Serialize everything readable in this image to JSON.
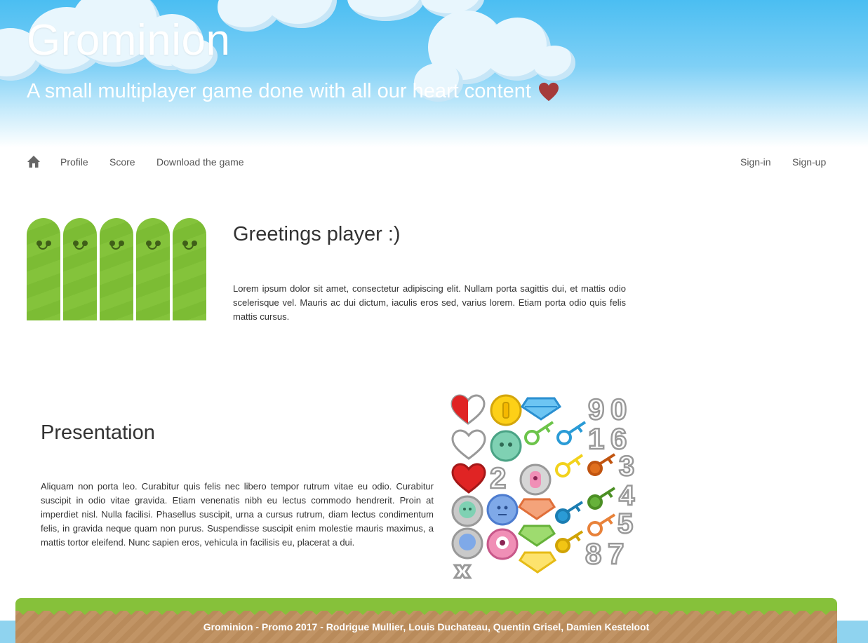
{
  "header": {
    "title": "Grominion",
    "subtitle": "A small multiplayer game done with all our heart content",
    "subtitle_icon": "heart-icon",
    "heart_color": "#a53b3b",
    "sky_color": "#4bbef2"
  },
  "nav": {
    "home_icon": "home-icon",
    "items": [
      "Profile",
      "Score",
      "Download the game"
    ],
    "right_items": [
      "Sign-in",
      "Sign-up"
    ]
  },
  "greetings": {
    "heading": "Greetings player :)",
    "text": "Lorem ipsum dolor sit amet, consectetur adipiscing elit. Nullam porta sagittis dui, et mattis odio scelerisque vel. Mauris ac dui dictum, iaculis eros sed, varius lorem. Etiam porta odio quis felis mattis cursus."
  },
  "presentation": {
    "heading": "Presentation",
    "text": "Aliquam non porta leo. Curabitur quis felis nec libero tempor rutrum vitae eu odio. Curabitur suscipit in odio vitae gravida. Etiam venenatis nibh eu lectus commodo hendrerit. Proin at imperdiet nisl. Nulla facilisi. Phasellus suscipit, urna a cursus rutrum, diam lectus condimentum felis, in gravida neque quam non purus. Suspendisse suscipit enim molestie mauris maximus, a mattis tortor eleifend. Nunc sapien eros, vehicula in facilisis eu, placerat a dui.",
    "sprite_digits": [
      "9",
      "0",
      "1",
      "6",
      "3",
      "2",
      "4",
      "5",
      "8",
      "7"
    ]
  },
  "footer": {
    "text": "Grominion - Promo 2017 - Rodrigue Mullier, Louis Duchateau, Quentin Grisel, Damien Kesteloot",
    "grass_color": "#86c13a",
    "dirt_color": "#c19465"
  }
}
